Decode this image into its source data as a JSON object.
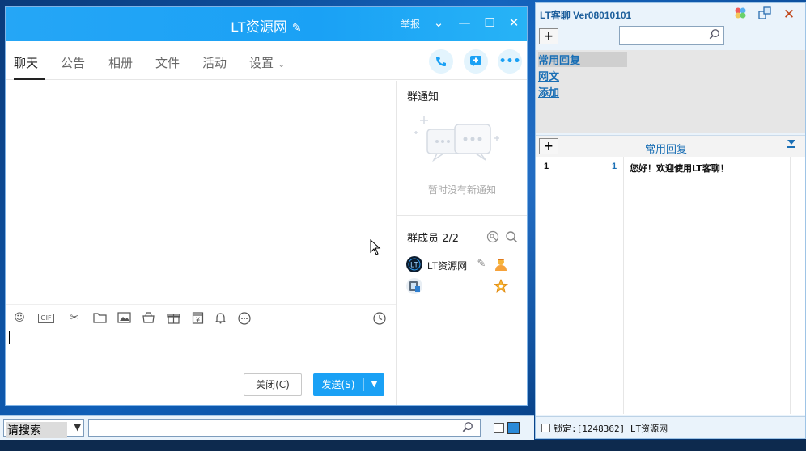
{
  "chat": {
    "title": "LT资源网",
    "title_edit_icon": "pencil-icon",
    "report_label": "举报",
    "window_controls": [
      "chevron-down-icon",
      "minimize-icon",
      "maximize-icon",
      "close-icon"
    ],
    "tabs": [
      {
        "label": "聊天",
        "active": true
      },
      {
        "label": "公告"
      },
      {
        "label": "相册"
      },
      {
        "label": "文件"
      },
      {
        "label": "活动"
      },
      {
        "label": "设置"
      }
    ],
    "settings_arrow": "⌄",
    "header_actions": [
      "phone-icon",
      "add-message-icon",
      "more-icon"
    ],
    "accent_color": "#1aa1f5",
    "toolbar_icons": [
      "emoji-icon",
      "gif-icon",
      "scissors-icon",
      "folder-icon",
      "image-icon",
      "shop-icon",
      "gift-icon",
      "red-packet-icon",
      "bell-icon",
      "more-icon",
      "history-icon"
    ],
    "gif_label": "GIF",
    "close_button": "关闭(C)",
    "send_button": "发送(S)",
    "notice": {
      "heading": "群通知",
      "empty_text": "暂时没有新通知"
    },
    "members": {
      "heading": "群成员 2/2",
      "list": [
        {
          "name": "LT资源网",
          "role_icon": "owner-icon"
        },
        {
          "name": "",
          "role_icon": "admin-star-icon"
        }
      ]
    }
  },
  "lt_panel": {
    "title": "LT客聊 Ver08010101",
    "title_icons": [
      "palette-icon",
      "layout-icon",
      "close-icon"
    ],
    "add_label": "+",
    "search_value": "",
    "links": [
      {
        "label": "常用回复",
        "selected": true
      },
      {
        "label": "网文"
      },
      {
        "label": "添加"
      }
    ],
    "grid": {
      "title": "常用回复",
      "rows": [
        {
          "index": "1",
          "count": "1",
          "text": "您好！欢迎使用LT客聊！"
        }
      ]
    },
    "status": "锁定:[1248362] LT资源网"
  },
  "bottom_bar": {
    "select_value": "请搜索",
    "search_value": ""
  }
}
